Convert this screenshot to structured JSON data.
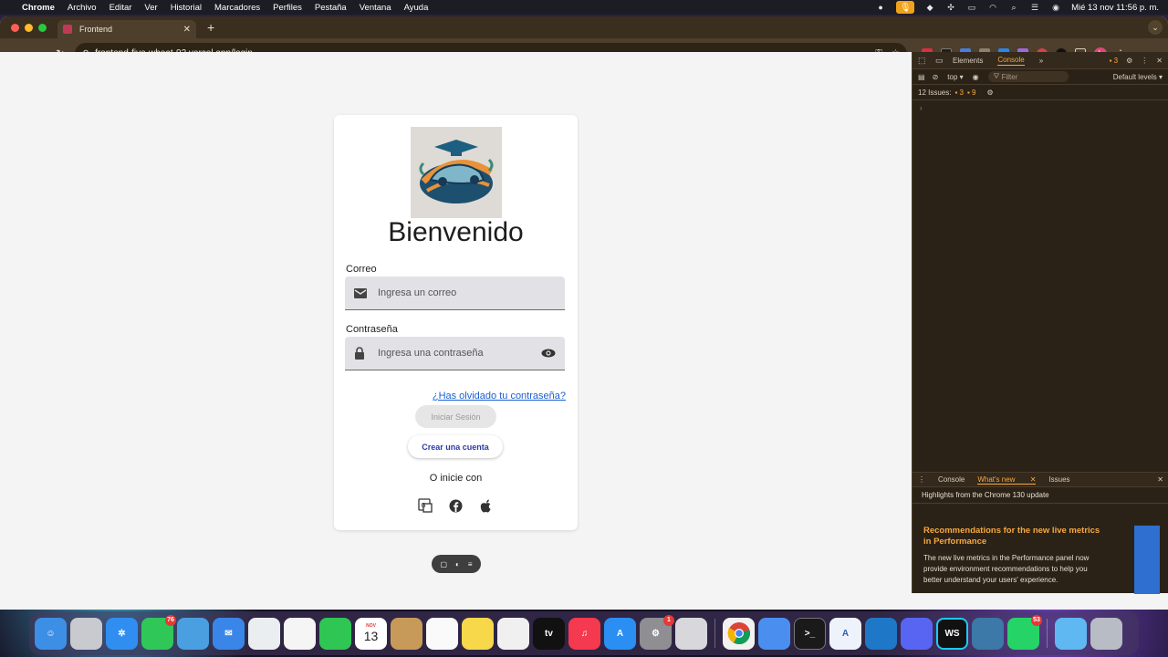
{
  "menubar": {
    "app": "Chrome",
    "items": [
      "Archivo",
      "Editar",
      "Ver",
      "Historial",
      "Marcadores",
      "Perfiles",
      "Pestaña",
      "Ventana",
      "Ayuda"
    ],
    "clock": "Mié 13 nov 11:56 p. m."
  },
  "browser": {
    "tab_title": "Frontend",
    "url": "frontend-five-wheat-92.vercel.app/login",
    "profile_initial": "L"
  },
  "login": {
    "title": "Bienvenido",
    "email_label": "Correo",
    "email_placeholder": "Ingresa un correo",
    "password_label": "Contraseña",
    "password_placeholder": "Ingresa una contraseña",
    "forgot": "¿Has olvidado tu contraseña?",
    "login_button": "Iniciar Sesión",
    "create_button": "Crear una cuenta",
    "or_text": "O inicie con"
  },
  "devtools": {
    "tabs": [
      "Elements",
      "Console"
    ],
    "active_tab": "Console",
    "issue_badge": "3",
    "context": "top",
    "filter_placeholder": "Filter",
    "levels": "Default levels",
    "issues_label": "12 Issues:",
    "issues_warn": "3",
    "issues_info": "9",
    "drawer_tabs": [
      "Console",
      "What's new",
      "Issues"
    ],
    "drawer_active": "What's new",
    "drawer_subtitle": "Highlights from the Chrome 130 update",
    "drawer_heading": "Recommendations for the new live metrics in Performance",
    "drawer_text": "The new live metrics in the Performance panel now provide environment recommendations to help you better understand your users' experience."
  },
  "dock": {
    "messages_badge": "76",
    "calendar_month": "NOV",
    "calendar_day": "13",
    "settings_badge": "1",
    "whatsapp_badge": "53",
    "tv_label": "tv"
  }
}
